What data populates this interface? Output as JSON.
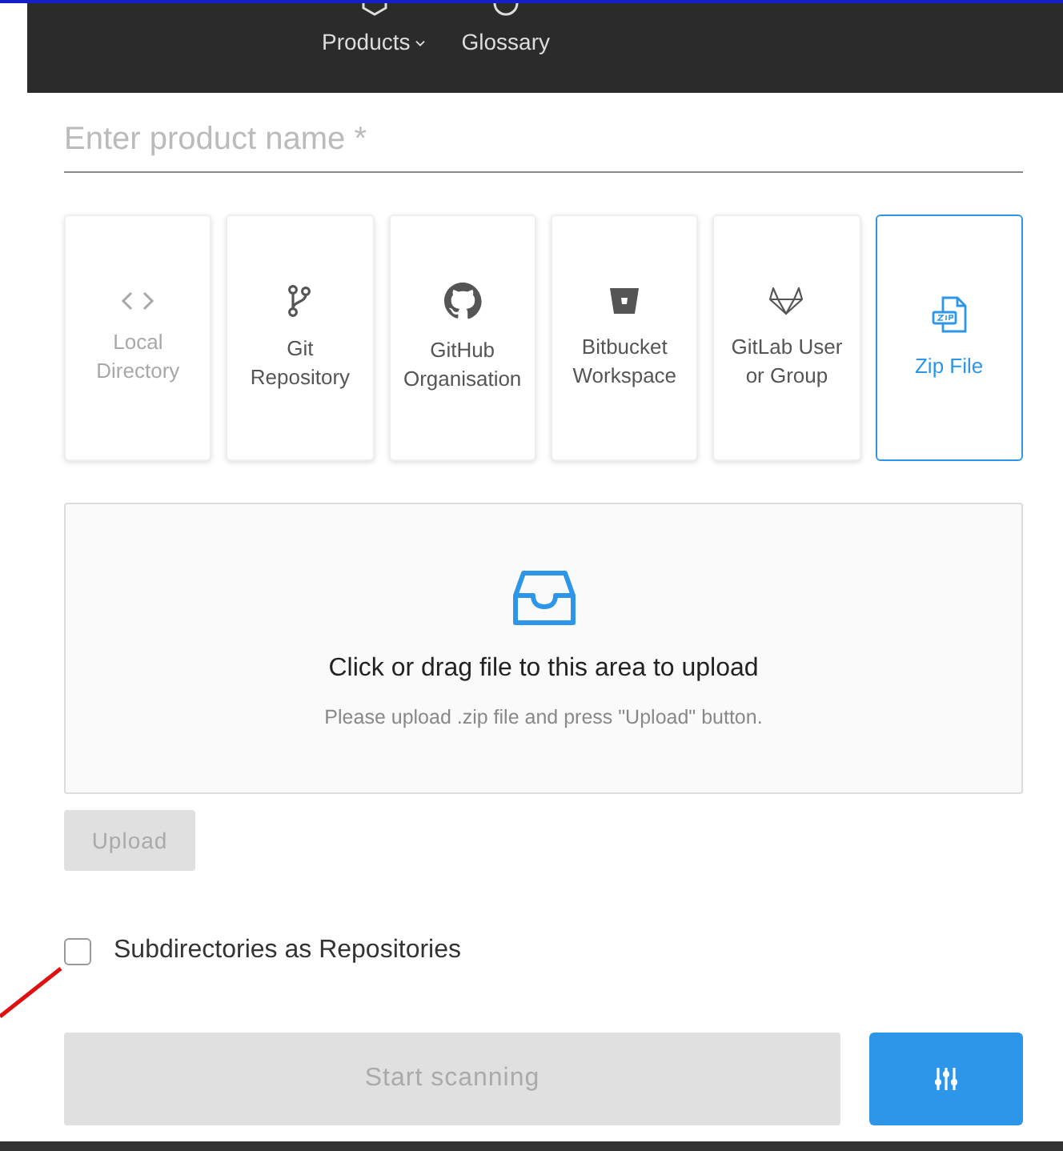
{
  "nav": [
    {
      "label": "Products",
      "has_menu": true
    },
    {
      "label": "Glossary",
      "has_menu": false
    }
  ],
  "product_name": {
    "placeholder": "Enter product name *"
  },
  "sources": [
    {
      "label": "Local Directory",
      "kind": "code",
      "disabled": true,
      "selected": false
    },
    {
      "label": "Git Repository",
      "kind": "branch",
      "disabled": false,
      "selected": false
    },
    {
      "label": "GitHub Organisation",
      "kind": "github",
      "disabled": false,
      "selected": false
    },
    {
      "label": "Bitbucket Workspace",
      "kind": "bucket",
      "disabled": false,
      "selected": false
    },
    {
      "label": "GitLab User or Group",
      "kind": "fox",
      "disabled": false,
      "selected": false
    },
    {
      "label": "Zip File",
      "kind": "zip",
      "disabled": false,
      "selected": true
    }
  ],
  "dropzone": {
    "title": "Click or drag file to this area to upload",
    "hint": "Please upload .zip file and press \"Upload\" button."
  },
  "upload_button": {
    "label": "Upload",
    "disabled": true
  },
  "subdirectories": {
    "label": "Subdirectories as Repositories",
    "checked": false
  },
  "start_button": {
    "label": "Start scanning",
    "disabled": true
  }
}
